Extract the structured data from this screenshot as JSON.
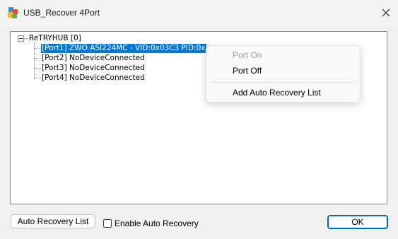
{
  "window": {
    "title": "USB_Recover 4Port",
    "icon": "usb-app-icon",
    "close_icon": "close-icon"
  },
  "tree": {
    "root_label": "ReTRYHUB [0]",
    "ports": [
      {
        "label": "[Port1] ZWO ASI224MC - VID:0x03C3 PID:0x"
      },
      {
        "label": "[Port2] NoDeviceConnected"
      },
      {
        "label": "[Port3] NoDeviceConnected"
      },
      {
        "label": "[Port4] NoDeviceConnected"
      }
    ],
    "selected_color": "#0078d7"
  },
  "context_menu": {
    "items": [
      {
        "label": "Port On",
        "enabled": false
      },
      {
        "label": "Port Off",
        "enabled": true
      },
      {
        "label": "Add Auto Recovery List",
        "enabled": true
      }
    ]
  },
  "footer": {
    "auto_recovery_list_button": "Auto Recovery List",
    "enable_auto_recovery_label": "Enable Auto Recovery",
    "enable_auto_recovery_checked": false,
    "ok_button": "OK"
  }
}
